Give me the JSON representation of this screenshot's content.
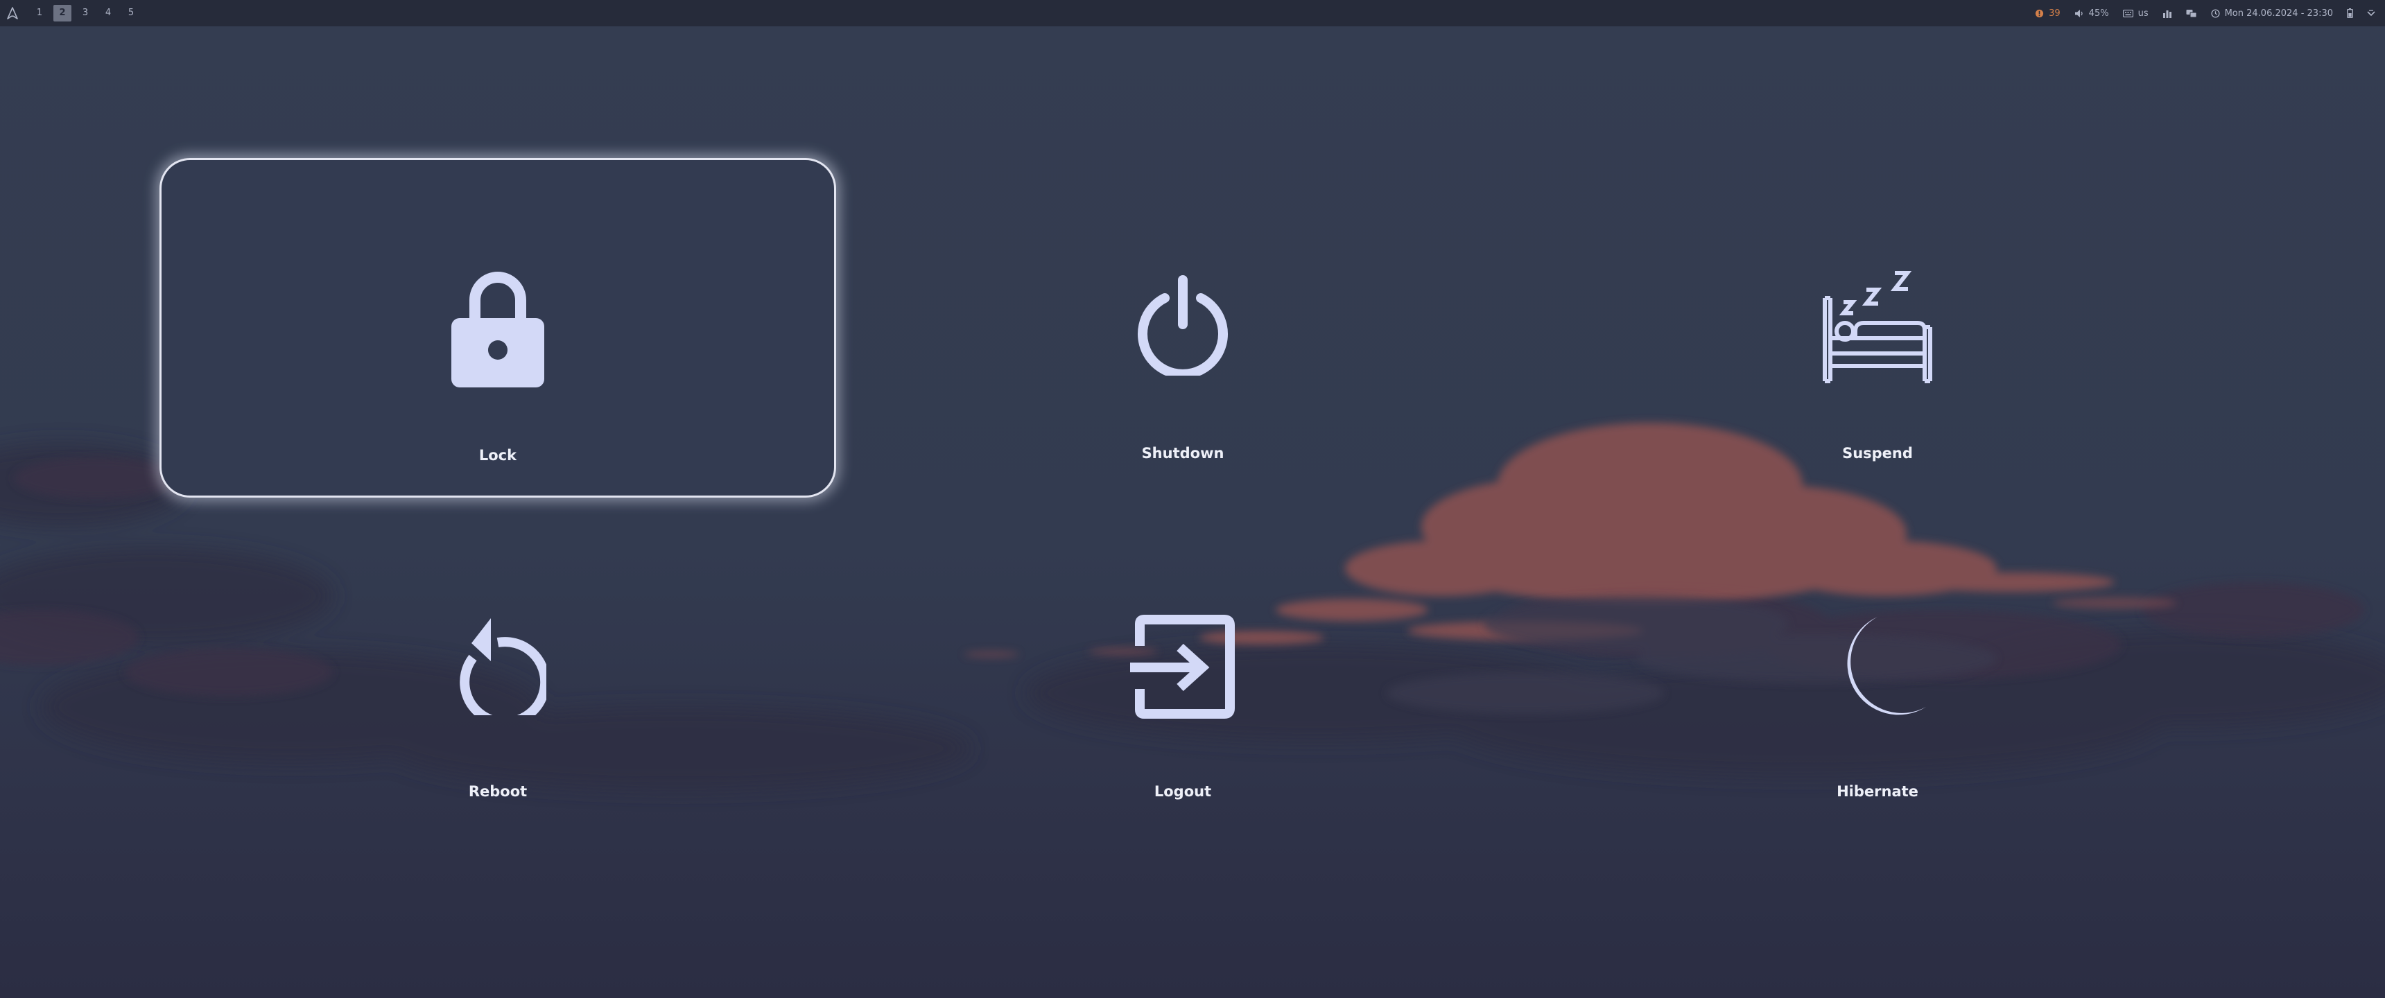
{
  "topbar": {
    "launcher_icon": "arch-logo-icon",
    "workspaces": [
      {
        "label": "1",
        "active": false
      },
      {
        "label": "2",
        "active": true
      },
      {
        "label": "3",
        "active": false
      },
      {
        "label": "4",
        "active": false
      },
      {
        "label": "5",
        "active": false
      }
    ],
    "updates": {
      "icon": "update-alert-icon",
      "value": "39"
    },
    "volume": {
      "icon": "speaker-icon",
      "value": "45%"
    },
    "keyboard": {
      "icon": "keyboard-icon",
      "value": "us"
    },
    "cpu_icon": "chart-icon",
    "memory_icon": "memory-icon",
    "clock": {
      "icon": "clock-icon",
      "value": "Mon 24.06.2024 - 23:30"
    },
    "power_icon": "battery-icon",
    "menu_icon": "chevron-down-icon"
  },
  "power_menu": [
    {
      "label": "Lock",
      "icon": "lock-icon",
      "selected": true
    },
    {
      "label": "Shutdown",
      "icon": "power-icon",
      "selected": false
    },
    {
      "label": "Suspend",
      "icon": "sleeping-bed-icon",
      "selected": false
    },
    {
      "label": "Reboot",
      "icon": "reboot-icon",
      "selected": false
    },
    {
      "label": "Logout",
      "icon": "logout-icon",
      "selected": false
    },
    {
      "label": "Hibernate",
      "icon": "moon-icon",
      "selected": false
    }
  ],
  "colors": {
    "icon": "#d3d9f7",
    "text": "#eef0f8",
    "bar": "#262b3a",
    "accent": "#d4804a"
  }
}
